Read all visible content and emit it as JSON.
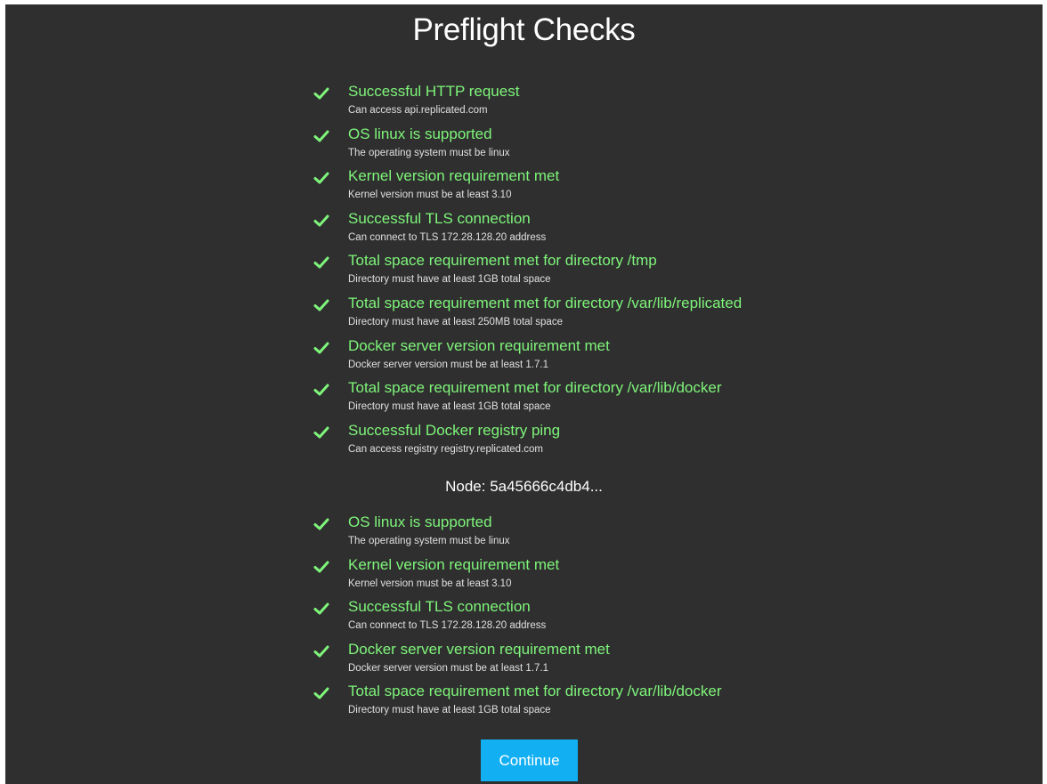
{
  "page": {
    "title": "Preflight Checks",
    "accent_color": "#7ef57a",
    "background_color": "#2f2f2f",
    "button_color": "#12b0f2"
  },
  "checks": [
    {
      "icon": "check-icon",
      "label": "Successful HTTP request",
      "description": "Can access api.replicated.com"
    },
    {
      "icon": "check-icon",
      "label": "OS linux is supported",
      "description": "The operating system must be linux"
    },
    {
      "icon": "check-icon",
      "label": "Kernel version requirement met",
      "description": "Kernel version must be at least 3.10"
    },
    {
      "icon": "check-icon",
      "label": "Successful TLS connection",
      "description": "Can connect to TLS 172.28.128.20 address"
    },
    {
      "icon": "check-icon",
      "label": "Total space requirement met for directory /tmp",
      "description": "Directory must have at least 1GB total space"
    },
    {
      "icon": "check-icon",
      "label": "Total space requirement met for directory /var/lib/replicated",
      "description": "Directory must have at least 250MB total space"
    },
    {
      "icon": "check-icon",
      "label": "Docker server version requirement met",
      "description": "Docker server version must be at least 1.7.1"
    },
    {
      "icon": "check-icon",
      "label": "Total space requirement met for directory /var/lib/docker",
      "description": "Directory must have at least 1GB total space"
    },
    {
      "icon": "check-icon",
      "label": "Successful Docker registry ping",
      "description": "Can access registry registry.replicated.com"
    }
  ],
  "node": {
    "heading": "Node: 5a45666c4db4...",
    "checks": [
      {
        "icon": "check-icon",
        "label": "OS linux is supported",
        "description": "The operating system must be linux"
      },
      {
        "icon": "check-icon",
        "label": "Kernel version requirement met",
        "description": "Kernel version must be at least 3.10"
      },
      {
        "icon": "check-icon",
        "label": "Successful TLS connection",
        "description": "Can connect to TLS 172.28.128.20 address"
      },
      {
        "icon": "check-icon",
        "label": "Docker server version requirement met",
        "description": "Docker server version must be at least 1.7.1"
      },
      {
        "icon": "check-icon",
        "label": "Total space requirement met for directory /var/lib/docker",
        "description": "Directory must have at least 1GB total space"
      }
    ]
  },
  "actions": {
    "continue_label": "Continue"
  }
}
